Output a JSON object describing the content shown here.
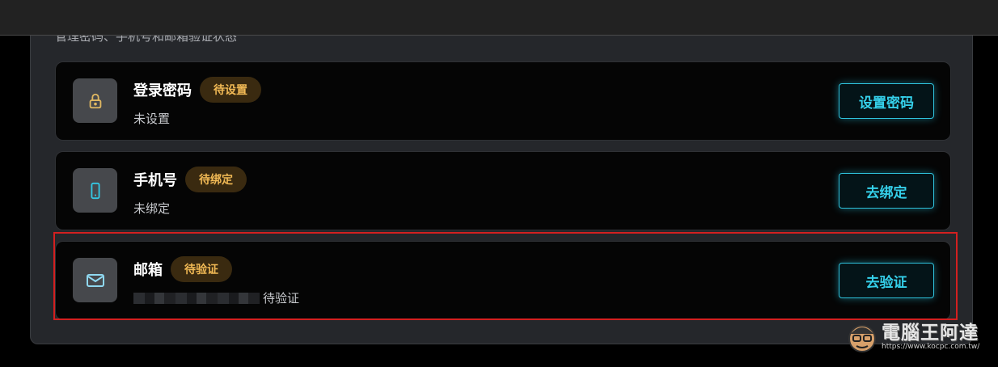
{
  "panel": {
    "subtitle": "管理密码、手机号和邮箱验证状态"
  },
  "cards": [
    {
      "title": "登录密码",
      "badge": "待设置",
      "subtitle": "未设置",
      "action": "设置密码",
      "icon": "lock-icon"
    },
    {
      "title": "手机号",
      "badge": "待绑定",
      "subtitle": "未绑定",
      "action": "去绑定",
      "icon": "phone-icon"
    },
    {
      "title": "邮箱",
      "badge": "待验证",
      "subtitle": "待验证",
      "action": "去验证",
      "icon": "mail-icon"
    }
  ],
  "watermark": {
    "title": "電腦王阿達",
    "url": "https://www.kocpc.com.tw/"
  },
  "colors": {
    "accent": "#35d0ea",
    "badge_text": "#f1b955",
    "badge_bg": "#3a2a10",
    "highlight": "#d32020"
  }
}
